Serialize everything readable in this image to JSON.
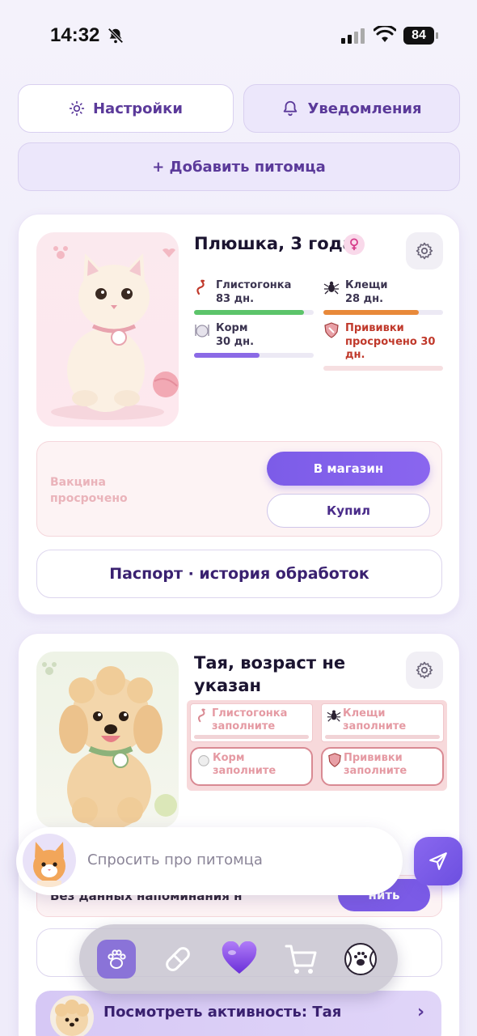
{
  "status_bar": {
    "time": "14:32",
    "battery": "84"
  },
  "top_buttons": {
    "settings": "Настройки",
    "notifications": "Уведомления"
  },
  "add_pet": "+ Добавить питомца",
  "pets": [
    {
      "name": "Плюшка, 3 года",
      "metrics": [
        {
          "label": "Глистогонка",
          "value": "83 дн.",
          "icon": "worm-icon",
          "progress": 0.92,
          "color": "#5cc46a"
        },
        {
          "label": "Клещи",
          "value": "28 дн.",
          "icon": "tick-icon",
          "progress": 0.8,
          "color": "#e8893a"
        },
        {
          "label": "Корм",
          "value": "30 дн.",
          "icon": "food-icon",
          "progress": 0.55,
          "color": "#8b6ae6"
        },
        {
          "label": "Прививки",
          "value": "просрочено 30 дн.",
          "value_line1": "просрочено 30",
          "value_line2": "дн.",
          "icon": "shield-icon",
          "progress": 0,
          "color": "#c0392b"
        }
      ],
      "alert": {
        "line1": "Вакцина",
        "line2": "просрочено"
      },
      "shop_button": "В магазин",
      "bought_button": "Купил",
      "passport_button": "Паспорт · история обработок"
    },
    {
      "name_line1": "Тая, возраст не",
      "name_line2": "указан",
      "metrics": [
        {
          "label": "Глистогонка",
          "value": "заполните",
          "icon": "worm-icon"
        },
        {
          "label": "Клещи",
          "value": "заполните",
          "icon": "tick-icon"
        },
        {
          "label": "Корм",
          "value": "заполните",
          "icon": "food-icon"
        },
        {
          "label": "Прививки",
          "value": "заполните",
          "icon": "shield-icon"
        }
      ],
      "reminder_text": "Без данных напоминания н",
      "reminder_button": "нить",
      "activity": "Посмотреть активность: Тая"
    }
  ],
  "ask": {
    "placeholder": "Спросить про питомца"
  },
  "tabs": [
    "paw-icon",
    "pill-icon",
    "heart-icon",
    "cart-icon",
    "ball-icon"
  ],
  "colors": {
    "accent": "#7c5ce8",
    "danger": "#c0392b"
  }
}
